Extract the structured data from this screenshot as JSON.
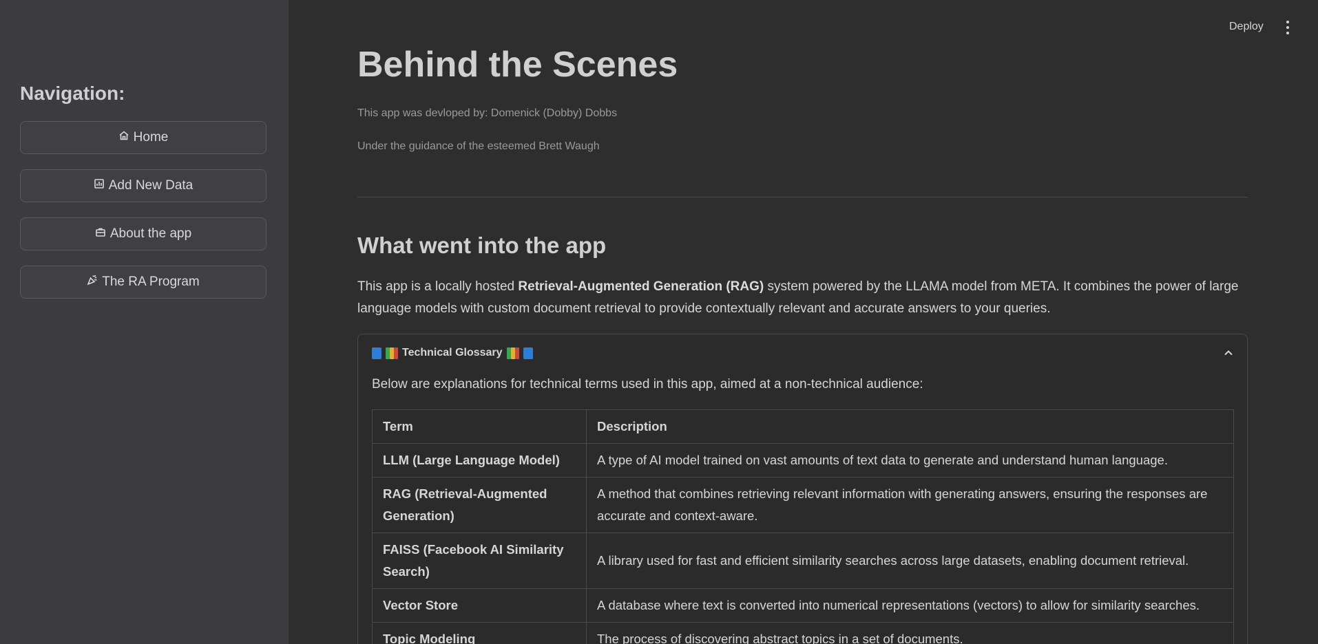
{
  "sidebar": {
    "heading": "Navigation:",
    "buttons": [
      {
        "label": "Home",
        "icon": "home-icon"
      },
      {
        "label": "Add New Data",
        "icon": "chart-icon"
      },
      {
        "label": "About the app",
        "icon": "briefcase-icon"
      },
      {
        "label": "The RA Program",
        "icon": "party-icon"
      }
    ]
  },
  "header": {
    "deploy_label": "Deploy",
    "menu_icon": "kebab-menu-icon"
  },
  "main": {
    "title": "Behind the Scenes",
    "author_line": "This app was devloped by: Domenick (Dobby) Dobbs",
    "guidance_line": "Under the guidance of the esteemed Brett Waugh",
    "section_title": "What went into the app",
    "intro": {
      "pre": "This app is a locally hosted ",
      "bold": "Retrieval-Augmented Generation (RAG)",
      "post": " system powered by the LLAMA model from META. It combines the power of large language models with custom document retrieval to provide contextually relevant and accurate answers to your queries."
    },
    "glossary": {
      "header_label": "Technical Glossary",
      "description": "Below are explanations for technical terms used in this app, aimed at a non-technical audience:",
      "columns": [
        "Term",
        "Description"
      ],
      "rows": [
        {
          "term": "LLM (Large Language Model)",
          "description": "A type of AI model trained on vast amounts of text data to generate and understand human language."
        },
        {
          "term": "RAG (Retrieval-Augmented Generation)",
          "description": "A method that combines retrieving relevant information with generating answers, ensuring the responses are accurate and context-aware."
        },
        {
          "term": "FAISS (Facebook AI Similarity Search)",
          "description": "A library used for fast and efficient similarity searches across large datasets, enabling document retrieval."
        },
        {
          "term": "Vector Store",
          "description": "A database where text is converted into numerical representations (vectors) to allow for similarity searches."
        },
        {
          "term": "Topic Modeling",
          "description": "The process of discovering abstract topics in a set of documents."
        }
      ]
    }
  },
  "colors": {
    "sidebar_bg": "#3b3b40",
    "main_bg": "#2e2e2f",
    "book_blue": "#2b7fd6"
  }
}
